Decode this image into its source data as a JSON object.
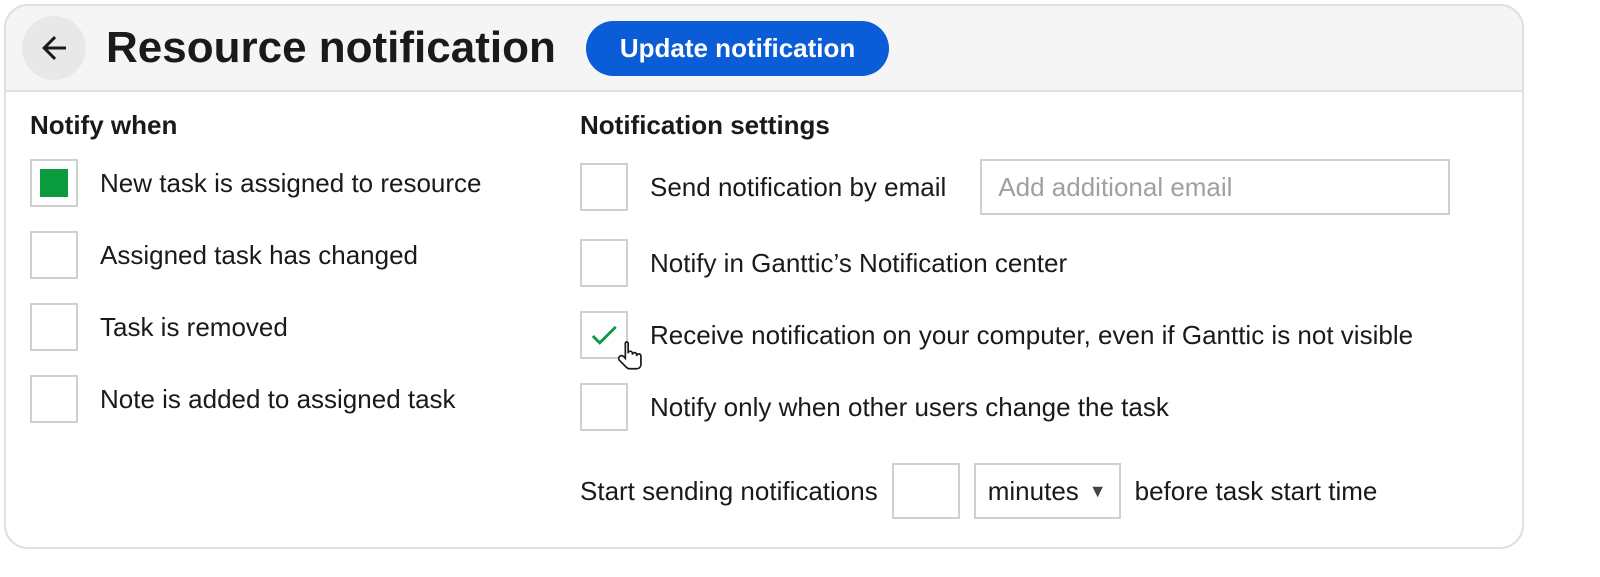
{
  "header": {
    "title": "Resource notification",
    "update_button": "Update notification"
  },
  "notify_when": {
    "title": "Notify when",
    "options": [
      {
        "label": "New task is assigned to resource",
        "checked": true
      },
      {
        "label": "Assigned task has changed",
        "checked": false
      },
      {
        "label": "Task is removed",
        "checked": false
      },
      {
        "label": "Note is added to assigned task",
        "checked": false
      }
    ]
  },
  "settings": {
    "title": "Notification settings",
    "email_label": "Send notification by email",
    "email_placeholder": "Add additional email",
    "email_value": "",
    "notify_center_label": "Notify in Ganttic’s Notification center",
    "notify_computer_label": "Receive notification on your computer, even if Ganttic is not visible",
    "notify_other_users_label": "Notify only when other users change the task",
    "timing_prefix": "Start sending notifications",
    "timing_value": "",
    "timing_unit": "minutes",
    "timing_suffix": "before task start time"
  },
  "colors": {
    "accent_blue": "#0a5cd7",
    "accent_green": "#0a9b3f"
  }
}
